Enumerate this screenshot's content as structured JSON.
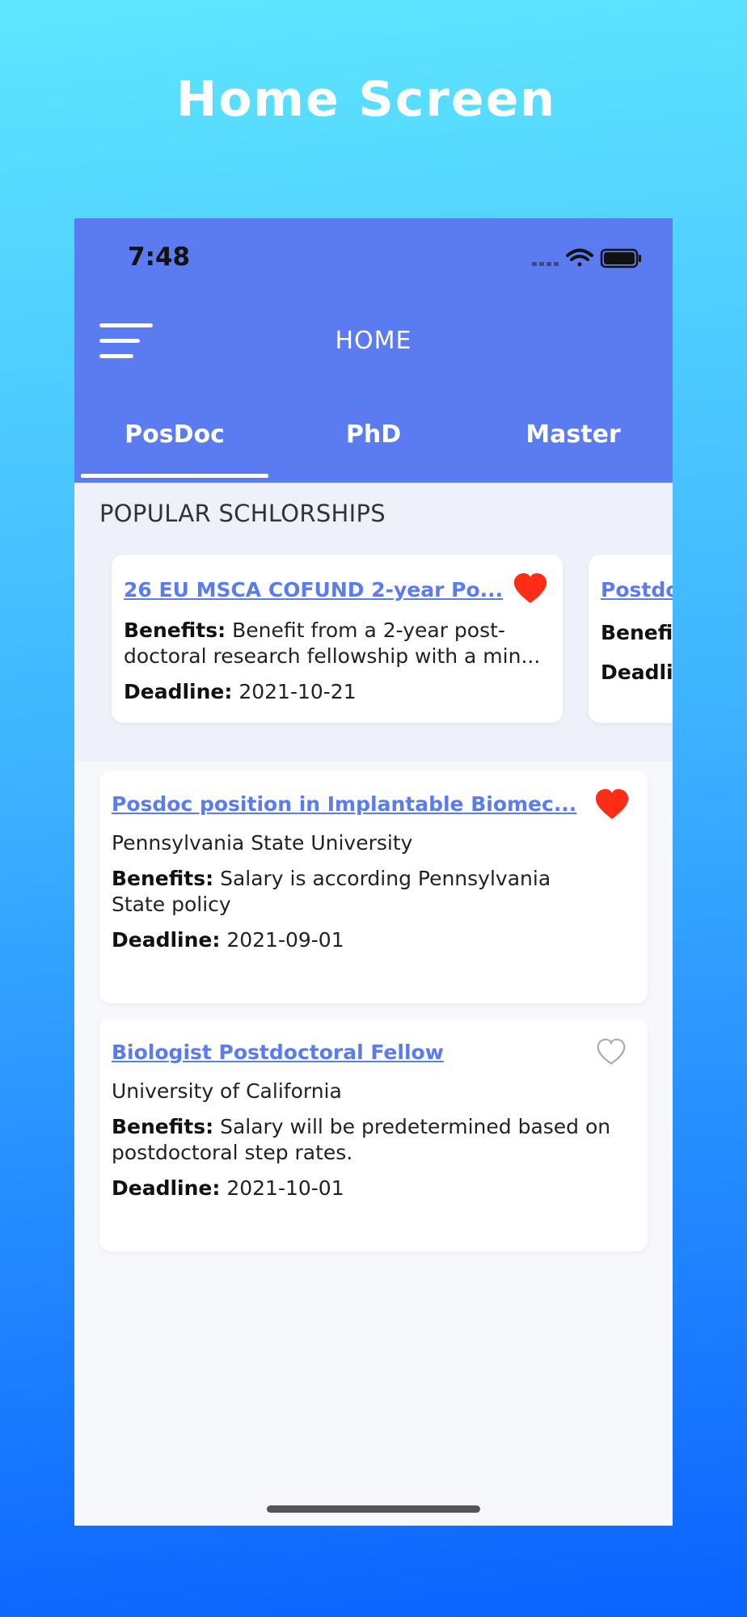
{
  "promo": {
    "title": "Home Screen"
  },
  "status_bar": {
    "time": "7:48",
    "icons": [
      "signal-icon",
      "wifi-icon",
      "battery-icon"
    ]
  },
  "header": {
    "title": "HOME",
    "menu_icon": "menu-icon"
  },
  "tabs": [
    {
      "label": "PosDoc",
      "selected": true
    },
    {
      "label": "PhD",
      "selected": false
    },
    {
      "label": "Master",
      "selected": false
    }
  ],
  "popular": {
    "section_title": "POPULAR SCHLORSHIPS",
    "cards": [
      {
        "title": "26 EU MSCA COFUND 2-year Po...",
        "benefits_label": "Benefits:",
        "benefits_line1": "Benefit from a 2-year post-",
        "benefits_line2": "doctoral research fellowship with a min...",
        "deadline_label": "Deadline:",
        "deadline": "2021-10-21",
        "favorited": true
      },
      {
        "title": "Postdo",
        "benefits_label": "Benefi",
        "deadline_label": "Deadli"
      }
    ]
  },
  "list": [
    {
      "title": "Posdoc position in Implantable Biomec...",
      "university": "Pennsylvania State University",
      "benefits_label": "Benefits:",
      "benefits_line1": "Salary is according Pennsylvania",
      "benefits_line2": "State policy",
      "deadline_label": "Deadline:",
      "deadline": "2021-09-01",
      "favorited": true
    },
    {
      "title": "Biologist Postdoctoral Fellow",
      "university": "University of California",
      "benefits_label": "Benefits:",
      "benefits_line1": "Salary will be predetermined based on",
      "benefits_line2": "postdoctoral step rates.",
      "deadline_label": "Deadline:",
      "deadline": "2021-10-01",
      "favorited": false
    }
  ],
  "colors": {
    "accent": "#5b7bf0",
    "heart": "#ff2d16",
    "heart_outline": "#aaaaaa"
  }
}
